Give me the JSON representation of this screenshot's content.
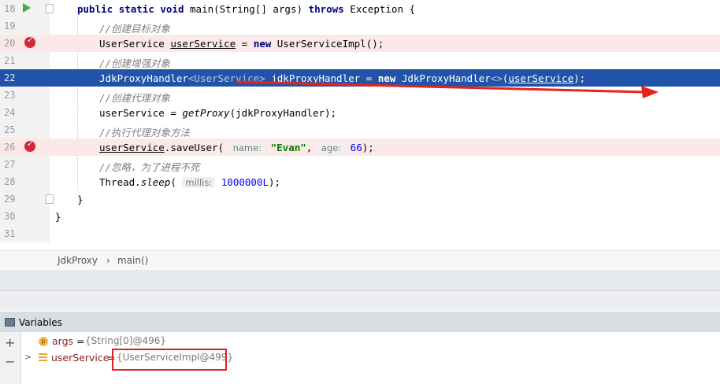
{
  "editor": {
    "lines": [
      {
        "n": "18"
      },
      {
        "n": "19"
      },
      {
        "n": "20"
      },
      {
        "n": "21"
      },
      {
        "n": "22"
      },
      {
        "n": "23"
      },
      {
        "n": "24"
      },
      {
        "n": "25"
      },
      {
        "n": "26"
      },
      {
        "n": "27"
      },
      {
        "n": "28"
      },
      {
        "n": "29"
      },
      {
        "n": "30"
      },
      {
        "n": "31"
      }
    ],
    "code": {
      "l18": {
        "public": "public",
        "static": "static",
        "void": "void",
        "sig": "main(String[] args)",
        "throws": "throws",
        "exc": "Exception {"
      },
      "l19": "//创建目标对象",
      "l20": {
        "type": "UserService ",
        "var": "userService",
        "eq": " = ",
        "new": "new",
        "impl": " UserServiceImpl();"
      },
      "l21": "//创建增强对象",
      "l22": {
        "t1": "JdkProxyHandler",
        "gen": "<UserService>",
        "t2": " jdkProxyHandler = ",
        "new": "new",
        "t3": " JdkProxyHandler",
        "dia": "<>",
        "p1": "(",
        "arg": "userService",
        "p2": ");"
      },
      "l23": "//创建代理对象",
      "l24": {
        "var": "userService",
        "eq": " = ",
        "call": "getProxy",
        "args": "(jdkProxyHandler);"
      },
      "l25": "//执行代理对象方法",
      "l26": {
        "var": "userService",
        "call": ".saveUser( ",
        "hint1": "name:",
        "s": "\"Evan\"",
        "comma": ", ",
        "hint2": "age:",
        "num": "66",
        "end": ");"
      },
      "l27": "//忽略，为了进程不死",
      "l28": {
        "cls": "Thread.",
        "call": "sleep",
        "open": "( ",
        "hint": "millis:",
        "num": "1000000L",
        "end": ");"
      },
      "l29": "}",
      "l30": "}"
    }
  },
  "breadcrumb": {
    "class": "JdkProxy",
    "sep": "›",
    "method": "main()"
  },
  "variables": {
    "title": "Variables",
    "add_label": "+",
    "remove_label": "−",
    "rows": [
      {
        "icon_text": "p",
        "name": "args",
        "eq": "=",
        "value": "{String[0]@496}"
      },
      {
        "expander": ">",
        "name": "userService",
        "eq": "=",
        "value": "{UserServiceImpl@499}"
      }
    ]
  },
  "colors": {
    "execution_line": "#2154a8",
    "breakpoint_line": "#fbe9e7",
    "annotation": "#e02020"
  }
}
